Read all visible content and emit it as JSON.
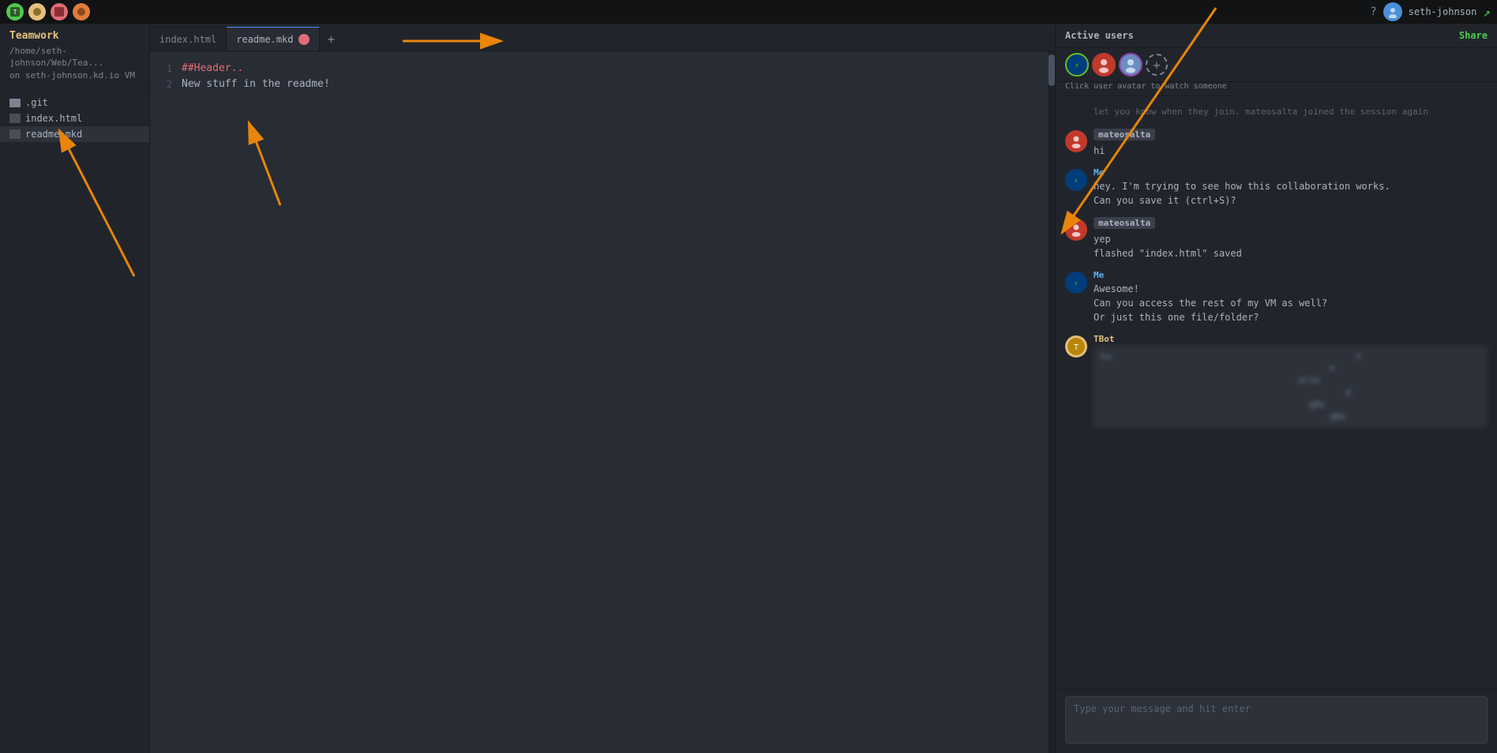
{
  "app": {
    "title": "Teamwork"
  },
  "topbar": {
    "icons": [
      {
        "name": "app-icon-1",
        "bg": "#4ec94e"
      },
      {
        "name": "app-icon-2",
        "bg": "#e5c07b"
      },
      {
        "name": "app-icon-3",
        "bg": "#e06c75"
      },
      {
        "name": "app-icon-4",
        "bg": "#61afef"
      },
      {
        "name": "app-icon-5",
        "bg": "#c678dd"
      }
    ],
    "username": "seth-johnson",
    "help_label": "?",
    "settings_label": "⚙"
  },
  "sidebar": {
    "title": "Teamwork",
    "path_line1": "/home/seth-johnson/Web/Tea...",
    "path_line2": "on seth-johnson.kd.io VM",
    "files": [
      {
        "name": ".git",
        "type": "folder"
      },
      {
        "name": "index.html",
        "type": "file",
        "active": false
      },
      {
        "name": "readme.mkd",
        "type": "file",
        "active": true
      }
    ]
  },
  "editor": {
    "tabs": [
      {
        "label": "index.html",
        "active": false,
        "has_avatar": false
      },
      {
        "label": "readme.mkd",
        "active": true,
        "has_avatar": true
      }
    ],
    "add_tab_label": "+",
    "lines": [
      {
        "number": 1,
        "code": "##Header.."
      },
      {
        "number": 2,
        "code": "New stuff in the readme!"
      }
    ]
  },
  "chat": {
    "active_users_label": "Active users",
    "share_label": "Share",
    "watch_hint": "Click user avatar to watch someone",
    "messages": [
      {
        "id": 1,
        "sender": "other",
        "name": "",
        "bubble_text": "",
        "text": "let you know when they join. mateosalta joined the session again",
        "is_system": true
      },
      {
        "id": 2,
        "sender": "other",
        "name": "mateosalta",
        "bubble_text": "",
        "text": "hi",
        "has_bubble": true
      },
      {
        "id": 3,
        "sender": "me",
        "name": "Me",
        "text": "hey. I'm trying to see how this collaboration works.\nCan you save it (ctrl+S)?",
        "has_bubble": false
      },
      {
        "id": 4,
        "sender": "other",
        "name": "mateosalta",
        "text": "yep\nflashed \"index.html\" saved",
        "has_bubble": true
      },
      {
        "id": 5,
        "sender": "me",
        "name": "Me",
        "text": "Awesome!\nCan you access the rest of my VM as well?\nOr just this one file/folder?",
        "has_bubble": false
      },
      {
        "id": 6,
        "sender": "bot",
        "name": "TBot",
        "text": "[blurred content]",
        "is_blurred": true
      }
    ],
    "input_placeholder": "Type your message and hit enter"
  },
  "arrows": [
    {
      "id": "arrow1",
      "description": "pointing to sidebar"
    },
    {
      "id": "arrow2",
      "description": "pointing to editor content"
    },
    {
      "id": "arrow3",
      "description": "pointing to tab"
    },
    {
      "id": "arrow4",
      "description": "pointing to chat message"
    }
  ]
}
